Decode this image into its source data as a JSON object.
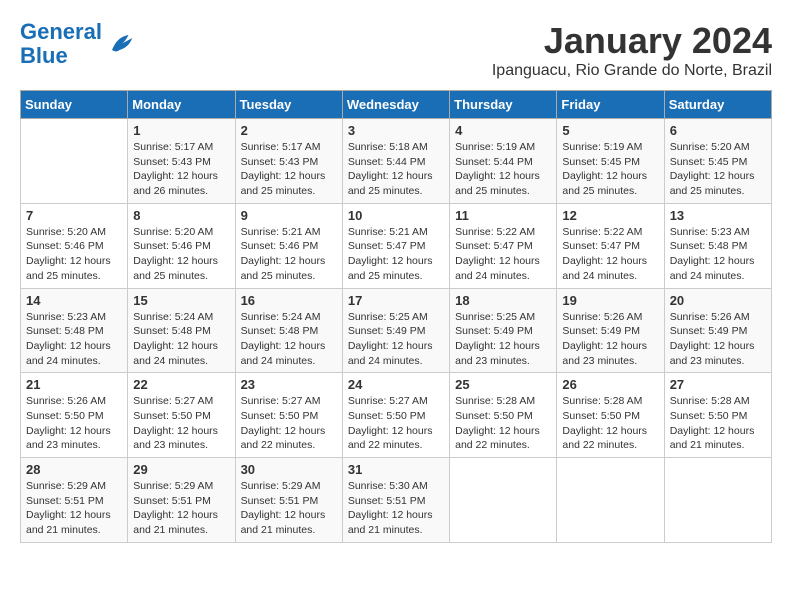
{
  "header": {
    "logo_line1": "General",
    "logo_line2": "Blue",
    "title": "January 2024",
    "location": "Ipanguacu, Rio Grande do Norte, Brazil"
  },
  "days_of_week": [
    "Sunday",
    "Monday",
    "Tuesday",
    "Wednesday",
    "Thursday",
    "Friday",
    "Saturday"
  ],
  "weeks": [
    [
      {
        "day": "",
        "info": ""
      },
      {
        "day": "1",
        "info": "Sunrise: 5:17 AM\nSunset: 5:43 PM\nDaylight: 12 hours\nand 26 minutes."
      },
      {
        "day": "2",
        "info": "Sunrise: 5:17 AM\nSunset: 5:43 PM\nDaylight: 12 hours\nand 25 minutes."
      },
      {
        "day": "3",
        "info": "Sunrise: 5:18 AM\nSunset: 5:44 PM\nDaylight: 12 hours\nand 25 minutes."
      },
      {
        "day": "4",
        "info": "Sunrise: 5:19 AM\nSunset: 5:44 PM\nDaylight: 12 hours\nand 25 minutes."
      },
      {
        "day": "5",
        "info": "Sunrise: 5:19 AM\nSunset: 5:45 PM\nDaylight: 12 hours\nand 25 minutes."
      },
      {
        "day": "6",
        "info": "Sunrise: 5:20 AM\nSunset: 5:45 PM\nDaylight: 12 hours\nand 25 minutes."
      }
    ],
    [
      {
        "day": "7",
        "info": "Sunrise: 5:20 AM\nSunset: 5:46 PM\nDaylight: 12 hours\nand 25 minutes."
      },
      {
        "day": "8",
        "info": "Sunrise: 5:20 AM\nSunset: 5:46 PM\nDaylight: 12 hours\nand 25 minutes."
      },
      {
        "day": "9",
        "info": "Sunrise: 5:21 AM\nSunset: 5:46 PM\nDaylight: 12 hours\nand 25 minutes."
      },
      {
        "day": "10",
        "info": "Sunrise: 5:21 AM\nSunset: 5:47 PM\nDaylight: 12 hours\nand 25 minutes."
      },
      {
        "day": "11",
        "info": "Sunrise: 5:22 AM\nSunset: 5:47 PM\nDaylight: 12 hours\nand 24 minutes."
      },
      {
        "day": "12",
        "info": "Sunrise: 5:22 AM\nSunset: 5:47 PM\nDaylight: 12 hours\nand 24 minutes."
      },
      {
        "day": "13",
        "info": "Sunrise: 5:23 AM\nSunset: 5:48 PM\nDaylight: 12 hours\nand 24 minutes."
      }
    ],
    [
      {
        "day": "14",
        "info": "Sunrise: 5:23 AM\nSunset: 5:48 PM\nDaylight: 12 hours\nand 24 minutes."
      },
      {
        "day": "15",
        "info": "Sunrise: 5:24 AM\nSunset: 5:48 PM\nDaylight: 12 hours\nand 24 minutes."
      },
      {
        "day": "16",
        "info": "Sunrise: 5:24 AM\nSunset: 5:48 PM\nDaylight: 12 hours\nand 24 minutes."
      },
      {
        "day": "17",
        "info": "Sunrise: 5:25 AM\nSunset: 5:49 PM\nDaylight: 12 hours\nand 24 minutes."
      },
      {
        "day": "18",
        "info": "Sunrise: 5:25 AM\nSunset: 5:49 PM\nDaylight: 12 hours\nand 23 minutes."
      },
      {
        "day": "19",
        "info": "Sunrise: 5:26 AM\nSunset: 5:49 PM\nDaylight: 12 hours\nand 23 minutes."
      },
      {
        "day": "20",
        "info": "Sunrise: 5:26 AM\nSunset: 5:49 PM\nDaylight: 12 hours\nand 23 minutes."
      }
    ],
    [
      {
        "day": "21",
        "info": "Sunrise: 5:26 AM\nSunset: 5:50 PM\nDaylight: 12 hours\nand 23 minutes."
      },
      {
        "day": "22",
        "info": "Sunrise: 5:27 AM\nSunset: 5:50 PM\nDaylight: 12 hours\nand 23 minutes."
      },
      {
        "day": "23",
        "info": "Sunrise: 5:27 AM\nSunset: 5:50 PM\nDaylight: 12 hours\nand 22 minutes."
      },
      {
        "day": "24",
        "info": "Sunrise: 5:27 AM\nSunset: 5:50 PM\nDaylight: 12 hours\nand 22 minutes."
      },
      {
        "day": "25",
        "info": "Sunrise: 5:28 AM\nSunset: 5:50 PM\nDaylight: 12 hours\nand 22 minutes."
      },
      {
        "day": "26",
        "info": "Sunrise: 5:28 AM\nSunset: 5:50 PM\nDaylight: 12 hours\nand 22 minutes."
      },
      {
        "day": "27",
        "info": "Sunrise: 5:28 AM\nSunset: 5:50 PM\nDaylight: 12 hours\nand 21 minutes."
      }
    ],
    [
      {
        "day": "28",
        "info": "Sunrise: 5:29 AM\nSunset: 5:51 PM\nDaylight: 12 hours\nand 21 minutes."
      },
      {
        "day": "29",
        "info": "Sunrise: 5:29 AM\nSunset: 5:51 PM\nDaylight: 12 hours\nand 21 minutes."
      },
      {
        "day": "30",
        "info": "Sunrise: 5:29 AM\nSunset: 5:51 PM\nDaylight: 12 hours\nand 21 minutes."
      },
      {
        "day": "31",
        "info": "Sunrise: 5:30 AM\nSunset: 5:51 PM\nDaylight: 12 hours\nand 21 minutes."
      },
      {
        "day": "",
        "info": ""
      },
      {
        "day": "",
        "info": ""
      },
      {
        "day": "",
        "info": ""
      }
    ]
  ]
}
